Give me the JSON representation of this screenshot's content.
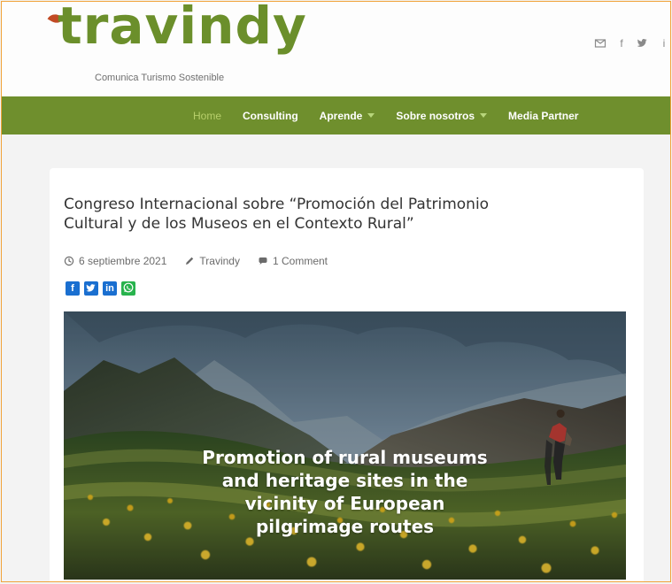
{
  "brand": {
    "name": "travindy",
    "tagline": "Comunica Turismo Sostenible",
    "primary_color": "#6f8f2d",
    "accent_leaf_color": "#c24a24"
  },
  "header": {
    "social_icons": [
      "mail-icon",
      "facebook-icon",
      "twitter-icon",
      "linkedin-icon"
    ]
  },
  "nav": {
    "items": [
      {
        "label": "Home",
        "active": true,
        "has_submenu": false
      },
      {
        "label": "Consulting",
        "active": false,
        "has_submenu": false
      },
      {
        "label": "Aprende",
        "active": false,
        "has_submenu": true
      },
      {
        "label": "Sobre nosotros",
        "active": false,
        "has_submenu": true
      },
      {
        "label": "Media Partner",
        "active": false,
        "has_submenu": false
      }
    ]
  },
  "article": {
    "title_line1": "Congreso Internacional sobre “Promoción del Patrimonio",
    "title_line2": "Cultural y de los Museos en el Contexto Rural”",
    "meta": {
      "date": "6 septiembre 2021",
      "author": "Travindy",
      "comments": "1 Comment"
    },
    "share_buttons": [
      {
        "name": "facebook",
        "label": "f",
        "color": "#1a6fd0"
      },
      {
        "name": "twitter",
        "label": "t",
        "color": "#1a6fd0"
      },
      {
        "name": "linkedin",
        "label": "in",
        "color": "#1a6fd0"
      },
      {
        "name": "whatsapp",
        "label": "",
        "color": "#28b34d"
      }
    ],
    "hero": {
      "caption_lines": [
        "Promotion of rural museums",
        "and heritage sites in the",
        "vicinity of European",
        "pilgrimage routes"
      ]
    }
  }
}
